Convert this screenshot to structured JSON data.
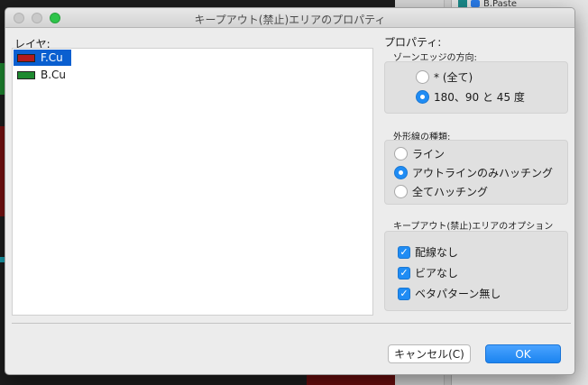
{
  "window": {
    "title": "キープアウト(禁止)エリアのプロパティ"
  },
  "layers": {
    "label": "レイヤ:",
    "items": [
      {
        "name": "F.Cu",
        "color": "#b31b1b",
        "selected": true
      },
      {
        "name": "B.Cu",
        "color": "#1e8a30",
        "selected": false
      }
    ]
  },
  "properties": {
    "label": "プロパティ:",
    "zone_direction": {
      "label": "ゾーンエッジの方向:",
      "options": [
        "* (全て)",
        "180、90 と 45 度"
      ],
      "selected": "180、90 と 45 度"
    },
    "outline_style": {
      "label": "外形線の種類:",
      "options": [
        "ライン",
        "アウトラインのみハッチング",
        "全てハッチング"
      ],
      "selected": "アウトラインのみハッチング"
    },
    "keepout_options": {
      "label": "キープアウト(禁止)エリアのオプション",
      "items": [
        {
          "label": "配線なし",
          "checked": true
        },
        {
          "label": "ビアなし",
          "checked": true
        },
        {
          "label": "ベタパターン無し",
          "checked": true
        }
      ]
    }
  },
  "buttons": {
    "cancel": "キャンセル(C)",
    "ok": "OK"
  },
  "background": {
    "peek_text": "B.Paste"
  }
}
